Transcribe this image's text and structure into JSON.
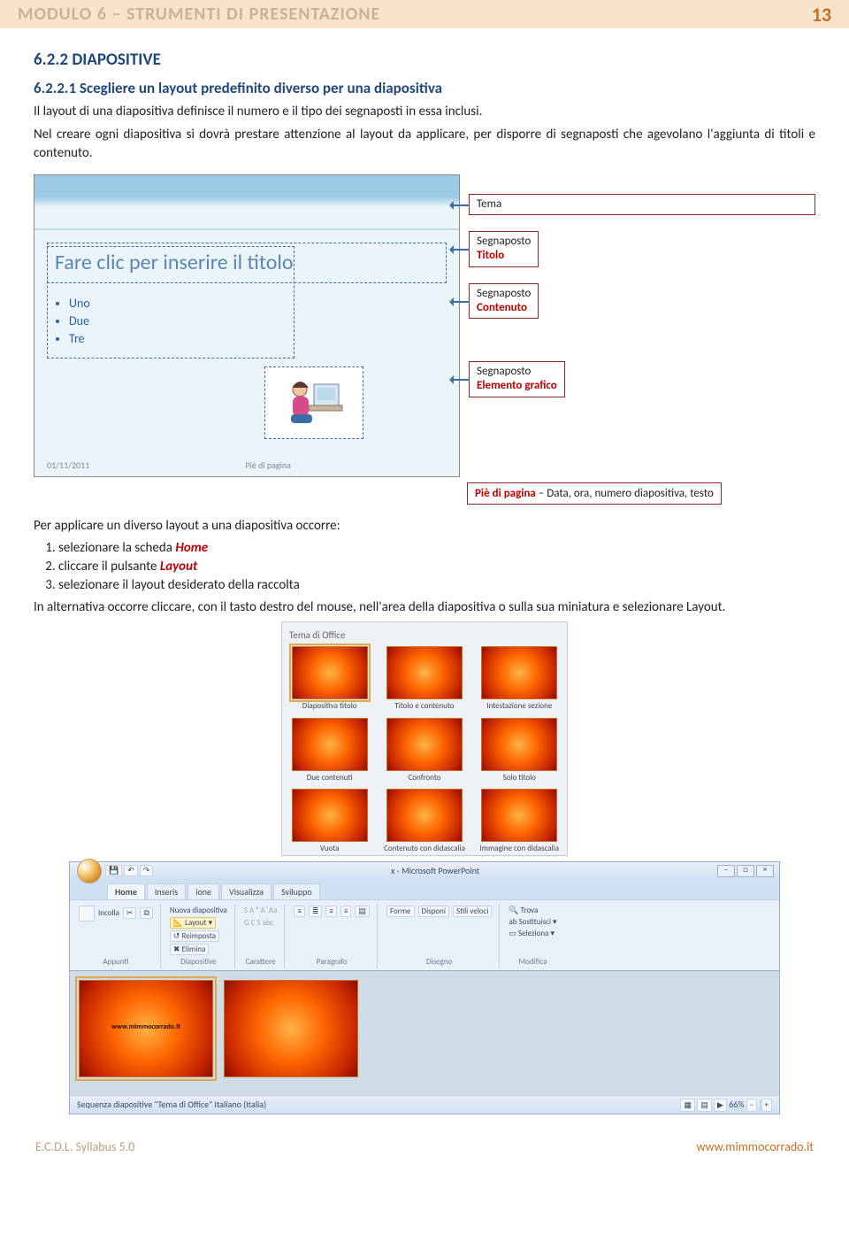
{
  "header": {
    "title": "MODULO 6 – STRUMENTI DI PRESENTAZIONE",
    "page": "13"
  },
  "section": {
    "h2": "6.2.2 DIAPOSITIVE",
    "h3": "6.2.2.1 Scegliere un layout predefinito diverso per una diapositiva"
  },
  "para1": "Il layout di una diapositiva definisce il numero e il tipo dei segnaposti in essa inclusi.",
  "para2": "Nel creare ogni diapositiva si dovrà prestare attenzione al layout da applicare, per disporre di segnaposti che agevolano l'aggiunta di titoli e contenuto.",
  "slide": {
    "title": "Fare clic per inserire il titolo",
    "bullets": [
      "Uno",
      "Due",
      "Tre"
    ],
    "date": "01/11/2011",
    "footer": "Piè di pagina"
  },
  "labels": {
    "tema": "Tema",
    "titolo_top": "Segnaposto",
    "titolo_red": "Titolo",
    "cont_top": "Segnaposto",
    "cont_red": "Contenuto",
    "graf_top": "Segnaposto",
    "graf_red": "Elemento grafico",
    "pie_red": "Piè di pagina",
    "pie_rest": " – Data, ora, numero diapositiva, testo"
  },
  "after_fig": "Per applicare un diverso layout a una diapositiva occorre:",
  "steps": {
    "s1a": "selezionare la scheda ",
    "s1b": "Home",
    "s2a": "cliccare il pulsante ",
    "s2b": "Layout",
    "s3": "selezionare il layout desiderato della raccolta"
  },
  "alt": "In alternativa occorre cliccare, con il tasto destro del mouse, nell'area della diapositiva o sulla sua miniatura e selezionare Layout.",
  "gallery": {
    "header": "Tema di Office",
    "items": [
      "Diapositiva titolo",
      "Titolo e contenuto",
      "Intestazione sezione",
      "Due contenuti",
      "Confronto",
      "Solo titolo",
      "Vuota",
      "Contenuto con didascalia",
      "Immagine con didascalia"
    ]
  },
  "ppt": {
    "title_suffix": "x - Microsoft PowerPoint",
    "tabs": [
      "Home",
      "Inseris",
      "ione",
      "Visualizza",
      "Sviluppo"
    ],
    "btn_layout": "Layout",
    "btn_reimposta": "Reimposta",
    "btn_elimina": "Elimina",
    "btn_nuova": "Nuova diapositiva",
    "btn_incolla": "Incolla",
    "group_appunti": "Appunti",
    "group_diapo": "Diapositive",
    "group_car": "Carattere",
    "group_para": "Paragrafo",
    "group_dis": "Disegno",
    "group_mod": "Modifica",
    "btn_forme": "Forme",
    "btn_disponi": "Disponi",
    "btn_stili": "Stili veloci",
    "btn_trova": "Trova",
    "btn_sost": "Sostituisci",
    "btn_selez": "Seleziona",
    "font_letters": "G  C  S  abc",
    "font_size": "S    A ᴬ    A ͮ    Aa",
    "status_left": "Sequenza diapositive    \"Tema di Office\"    Italiano (Italia)",
    "zoom": "66%",
    "slide_text": "www.mimmocorrado.it"
  },
  "footer": {
    "left": "E.C.D.L.  Syllabus 5.0",
    "right": "www.mimmocorrado.it"
  }
}
